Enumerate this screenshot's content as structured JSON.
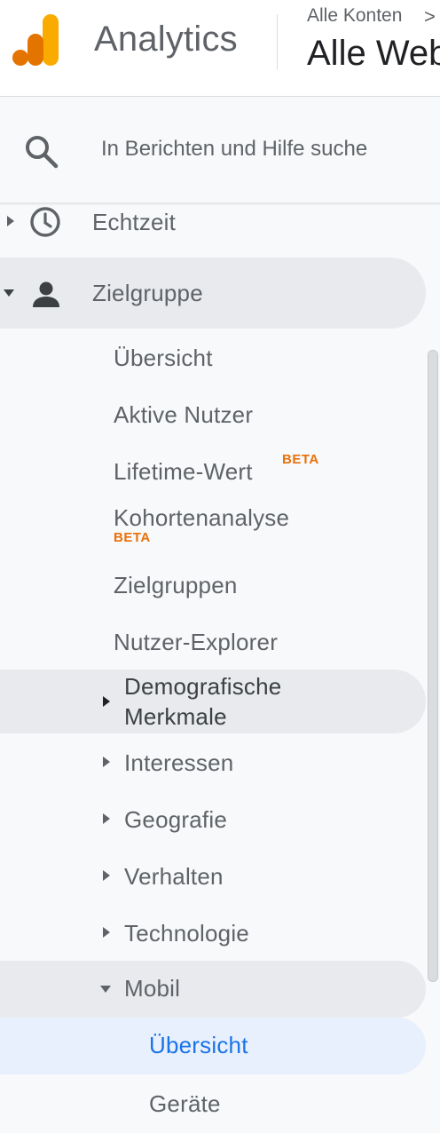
{
  "header": {
    "app_name": "Analytics",
    "account_crumb": "Alle Konten",
    "crumb_chevron": ">",
    "property_name": "Alle Websit",
    "logo_colors": [
      "#e37400",
      "#f9ab00"
    ]
  },
  "search": {
    "placeholder": "In Berichten und Hilfe suche",
    "icon": "search-icon"
  },
  "nav": {
    "echtzeit": "Echtzeit",
    "zielgruppe": "Zielgruppe",
    "uebersicht": "Übersicht",
    "aktive_nutzer": "Aktive Nutzer",
    "lifetime_wert": "Lifetime-Wert",
    "lifetime_badge": "BETA",
    "kohortenanalyse": "Kohortenanalyse",
    "kohorten_badge": "BETA",
    "zielgruppen": "Zielgruppen",
    "nutzer_explorer": "Nutzer-Explorer",
    "demografische_1": "Demografische",
    "demografische_2": "Merkmale",
    "interessen": "Interessen",
    "geografie": "Geografie",
    "verhalten": "Verhalten",
    "technologie": "Technologie",
    "mobil": "Mobil",
    "mobil_uebersicht": "Übersicht",
    "geraete": "Geräte"
  },
  "colors": {
    "accent": "#1a73e8",
    "beta": "#e8710a",
    "pill": "#e8eaed",
    "active_pill": "#e8f0fe"
  }
}
